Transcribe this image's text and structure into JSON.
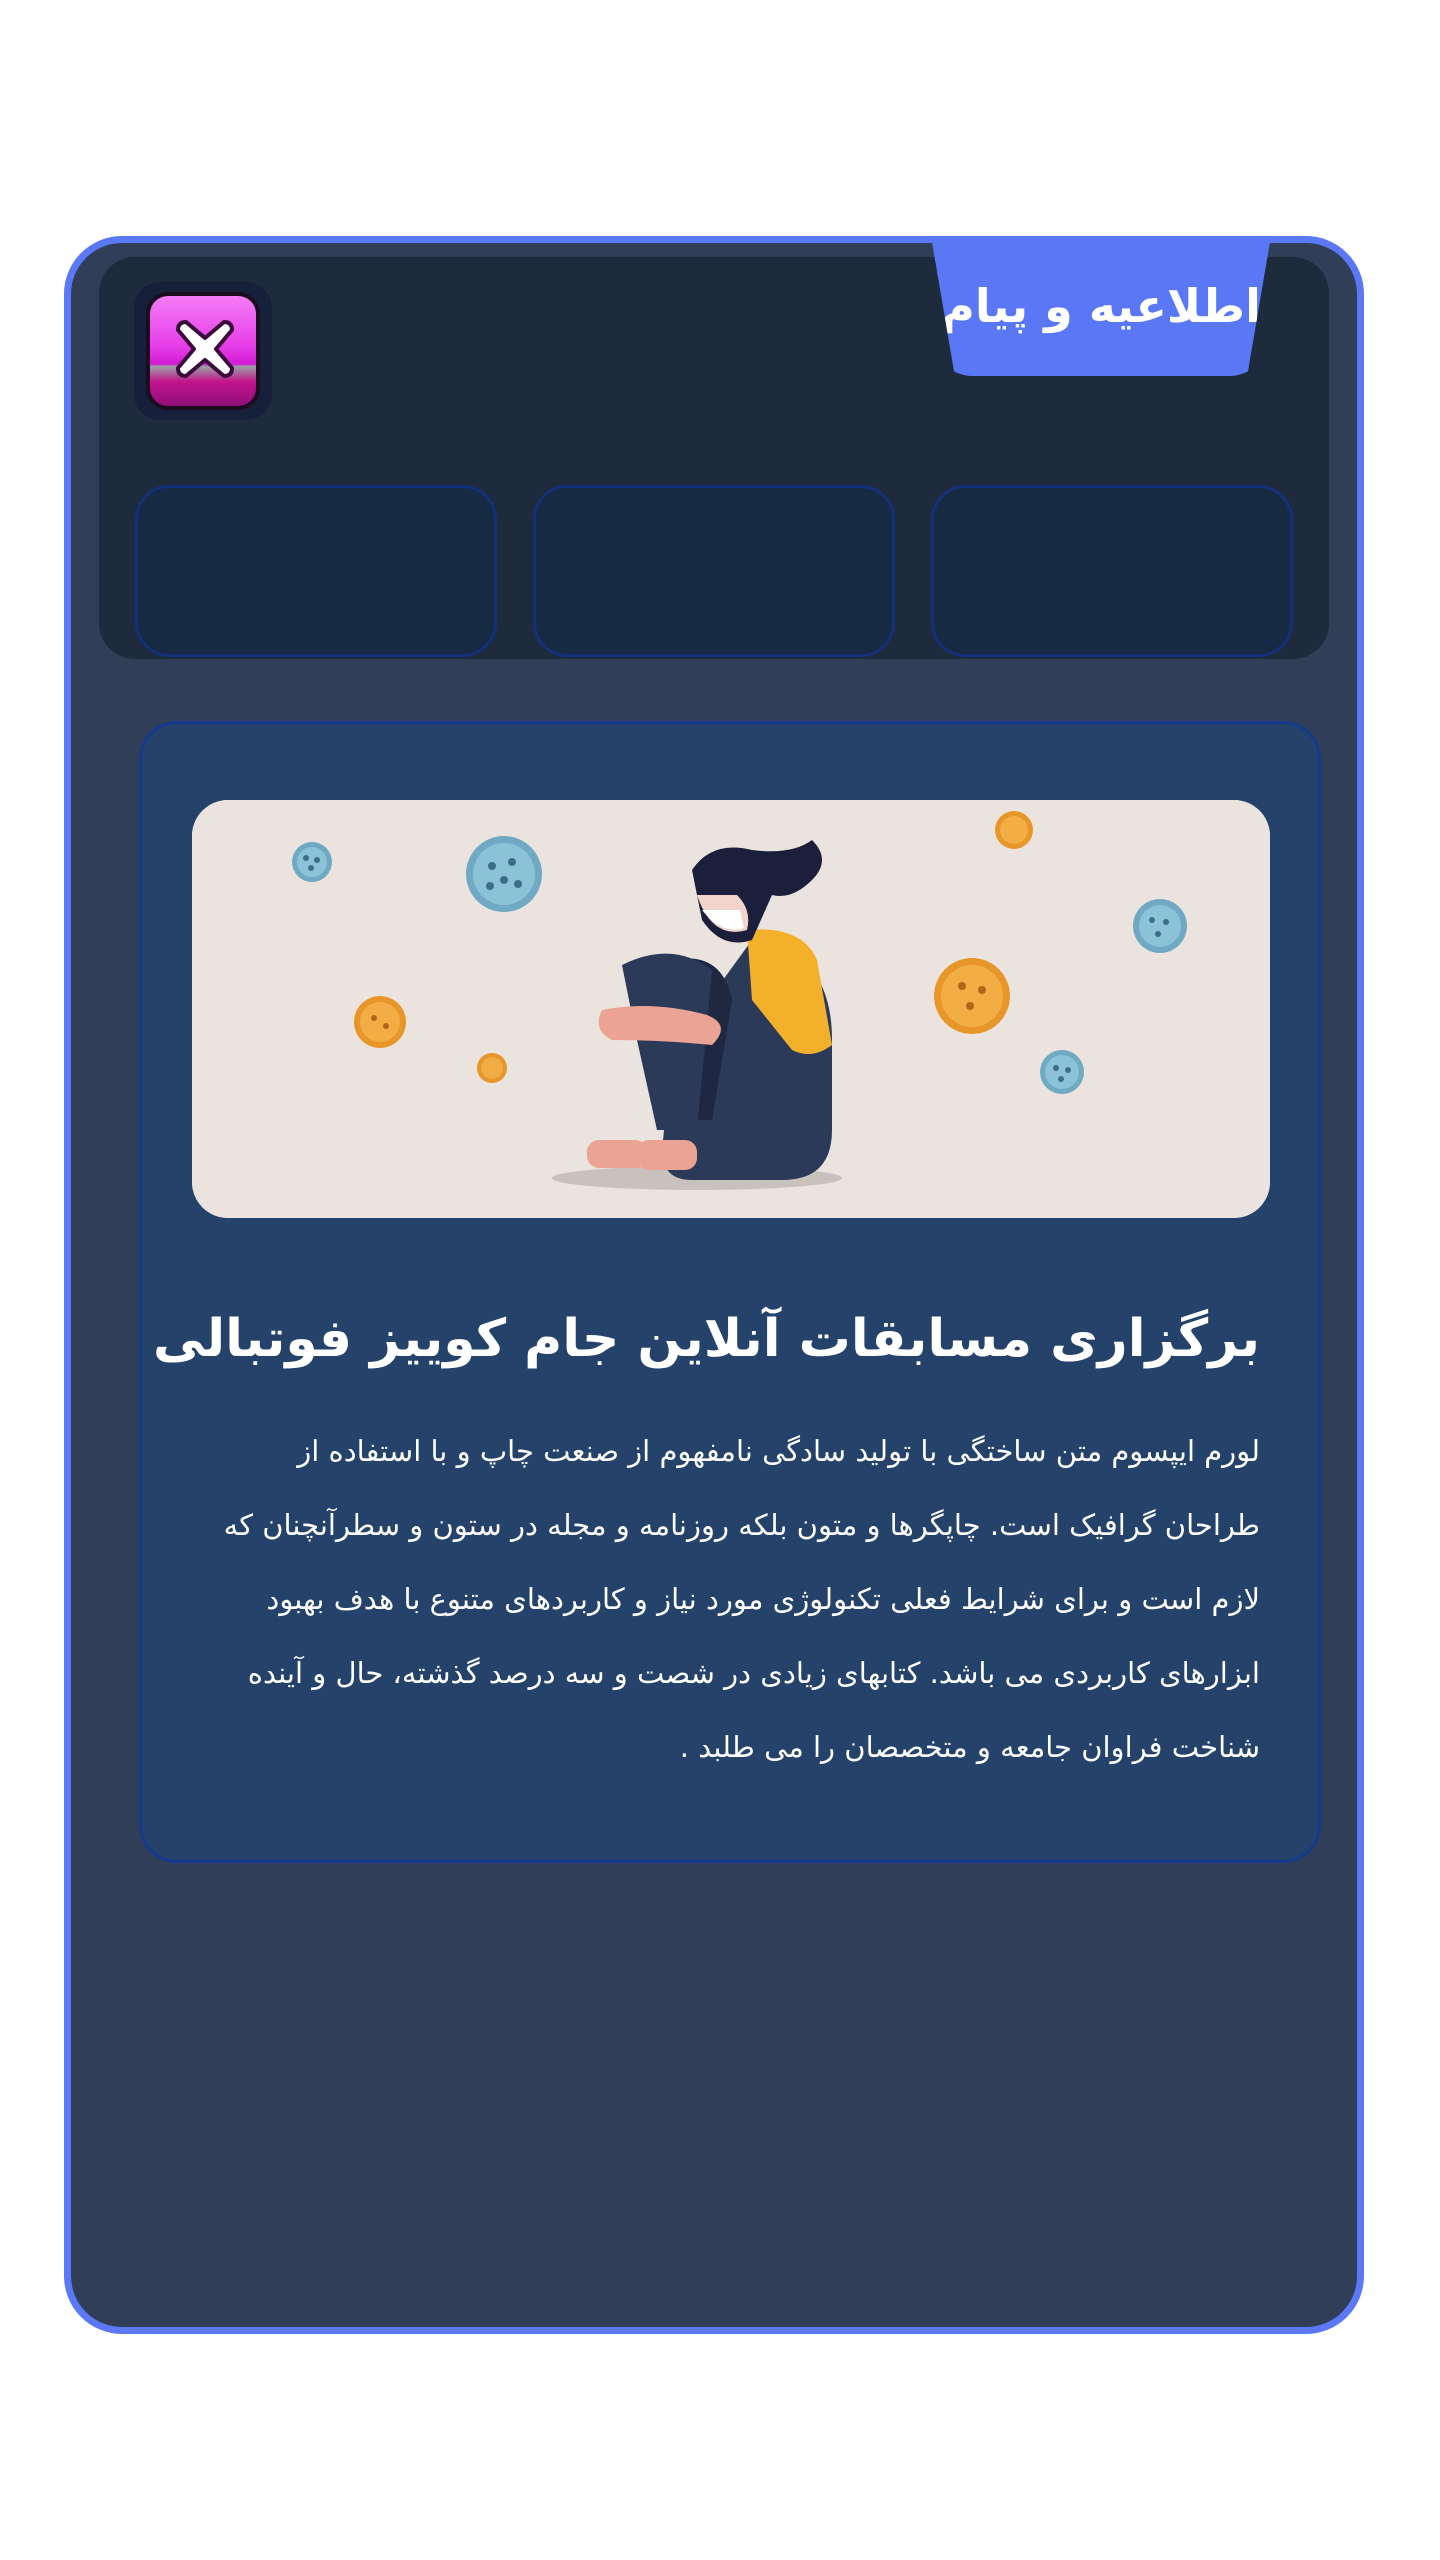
{
  "dialog": {
    "title": "اطلاعیه و پیام",
    "close_label": "close"
  },
  "tabs": [
    {
      "label": ""
    },
    {
      "label": ""
    },
    {
      "label": ""
    }
  ],
  "news": {
    "image_alt": "woman sitting with mask among virus particles",
    "title": "برگزاری مسابقات آنلاین جام کوییز فوتبالی",
    "body": "لورم ایپسوم متن ساختگی با تولید سادگی نامفهوم از صنعت چاپ و با استفاده از طراحان گرافیک است. چاپگرها و متون بلکه روزنامه و مجله در ستون و سطرآنچنان که لازم است و برای شرایط فعلی تکنولوژی مورد نیاز و کاربردهای متنوع با هدف بهبود ابزارهای کاربردی می باشد. کتابهای زیادی در شصت و سه درصد گذشته، حال و آینده شناخت فراوان جامعه و متخصصان را می طلبد ."
  },
  "colors": {
    "frame": "#5b78f6",
    "panel": "#303f57",
    "top_area": "#1d2b3c",
    "card": "#24426a",
    "close_button": "#e63fe8"
  }
}
